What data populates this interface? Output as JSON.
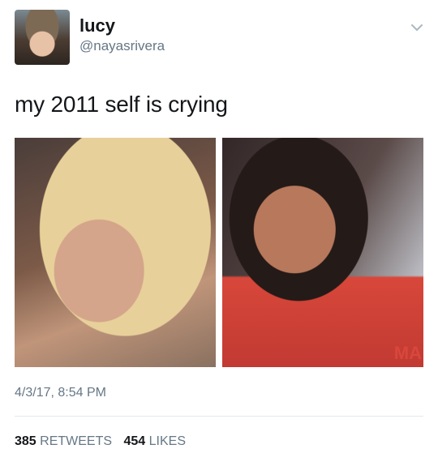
{
  "user": {
    "name": "lucy",
    "handle": "@nayasrivera"
  },
  "tweet": {
    "text": "my 2011 self is crying",
    "timestamp": "4/3/17, 8:54 PM"
  },
  "media": {
    "watermark": "MA"
  },
  "stats": {
    "retweets_count": "385",
    "retweets_label": "RETWEETS",
    "likes_count": "454",
    "likes_label": "LIKES"
  },
  "icons": {
    "menu": "chevron-down-icon"
  },
  "colors": {
    "text": "#14171a",
    "secondary": "#657786",
    "divider": "#e1e8ed"
  }
}
